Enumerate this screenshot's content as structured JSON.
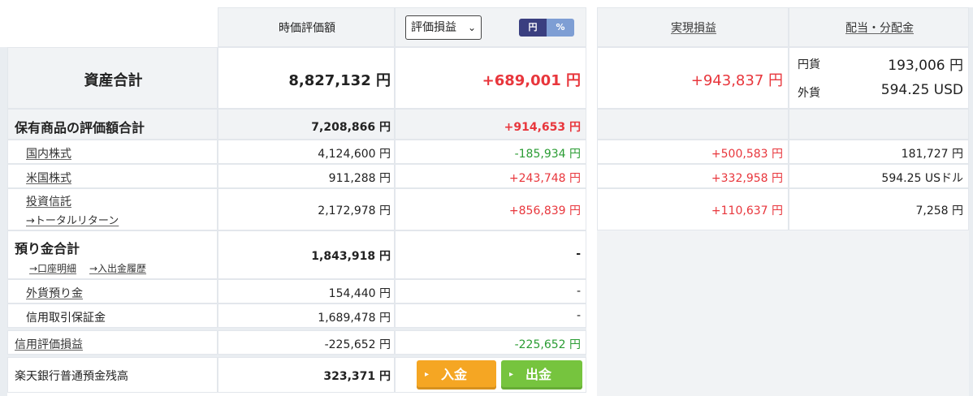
{
  "header": {
    "col_market_value": "時価評価額",
    "select_value": "評価損益",
    "toggle_yen": "円",
    "toggle_percent": "%",
    "col_realized": "実現損益",
    "col_dividend": "配当・分配金"
  },
  "total_assets": {
    "label": "資産合計",
    "value": "8,827,132 円",
    "gain": "+689,001 円",
    "realized": "+943,837 円",
    "dividend_jpy_label": "円貨",
    "dividend_jpy_value": "193,006 円",
    "dividend_fx_label": "外貨",
    "dividend_fx_value": "594.25 USD"
  },
  "holdings_total": {
    "label": "保有商品の評価額合計",
    "value": "7,208,866 円",
    "gain": "+914,653 円"
  },
  "rows": [
    {
      "label": "国内株式",
      "value": "4,124,600 円",
      "gain": "-185,934 円",
      "realized": "+500,583 円",
      "dividend": "181,727 円"
    },
    {
      "label": "米国株式",
      "value": "911,288 円",
      "gain": "+243,748 円",
      "realized": "+332,958 円",
      "dividend": "594.25 USドル"
    },
    {
      "label": "投資信託",
      "sub_link": "→トータルリターン",
      "value": "2,172,978 円",
      "gain": "+856,839 円",
      "realized": "+110,637 円",
      "dividend": "7,258 円"
    }
  ],
  "deposit_total": {
    "label": "預り金合計",
    "link_statement": "→口座明細",
    "link_history": "→入出金履歴",
    "value": "1,843,918 円",
    "gain": "-"
  },
  "deposit_rows": [
    {
      "label": "外貨預り金",
      "value": "154,440 円",
      "gain": "-"
    },
    {
      "label": "信用取引保証金",
      "value": "1,689,478 円",
      "gain": "-"
    }
  ],
  "margin": {
    "label": "信用評価損益",
    "value": "-225,652 円",
    "gain": "-225,652 円"
  },
  "bank": {
    "label": "楽天銀行普通預金残高",
    "value": "323,371 円",
    "deposit_button": "入金",
    "withdraw_button": "出金"
  },
  "colors": {
    "positive": "#e8363c",
    "negative": "#2a9c33",
    "deposit_button": "#f5a623",
    "withdraw_button": "#76c43e"
  }
}
